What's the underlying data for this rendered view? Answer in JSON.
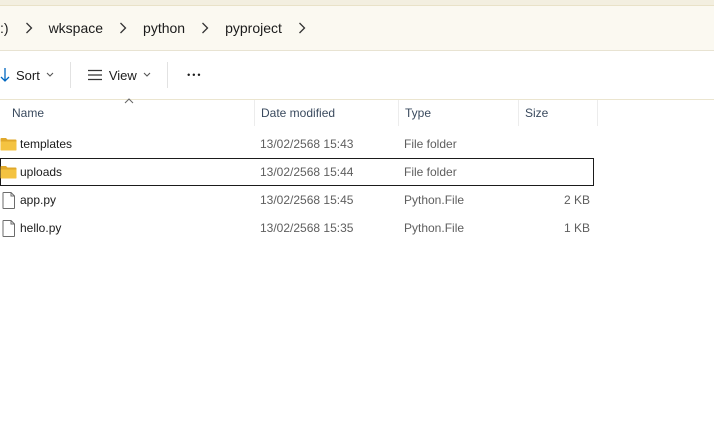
{
  "breadcrumb": {
    "items": [
      ":)",
      "wkspace",
      "python",
      "pyproject"
    ]
  },
  "toolbar": {
    "sort_label": "Sort",
    "view_label": "View",
    "more_label": "•••"
  },
  "columns": {
    "name": "Name",
    "date": "Date modified",
    "type": "Type",
    "size": "Size"
  },
  "files": [
    {
      "name": "templates",
      "date": "13/02/2568 15:43",
      "type": "File folder",
      "size": "",
      "icon": "folder-icon"
    },
    {
      "name": "uploads",
      "date": "13/02/2568 15:44",
      "type": "File folder",
      "size": "",
      "icon": "folder-icon"
    },
    {
      "name": "app.py",
      "date": "13/02/2568 15:45",
      "type": "Python.File",
      "size": "2 KB",
      "icon": "file-icon"
    },
    {
      "name": "hello.py",
      "date": "13/02/2568 15:35",
      "type": "Python.File",
      "size": "1 KB",
      "icon": "file-icon"
    }
  ],
  "colors": {
    "folder": "#f4c341",
    "folder_dark": "#e0a82b",
    "accent": "#0067c0"
  }
}
